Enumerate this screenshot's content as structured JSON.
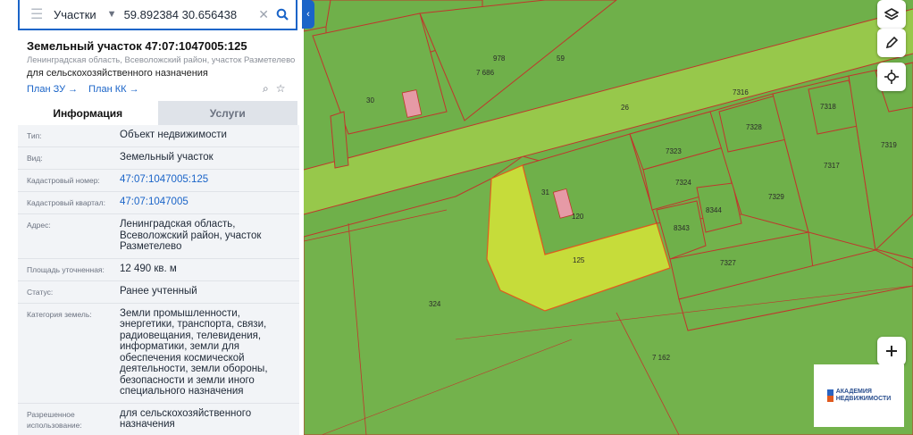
{
  "search": {
    "scope": "Участки",
    "query": "59.892384 30.656438"
  },
  "object": {
    "title": "Земельный участок 47:07:1047005:125",
    "address": "Ленинградская область, Всеволожский район, участок Разметелево",
    "purpose": "для сельскохозяйственного назначения",
    "links": [
      "План ЗУ →",
      "План КК →"
    ]
  },
  "tabs": [
    "Информация",
    "Услуги"
  ],
  "info_rows": [
    {
      "label": "Тип:",
      "value": "Объект недвижимости",
      "link": false
    },
    {
      "label": "Вид:",
      "value": "Земельный участок",
      "link": false
    },
    {
      "label": "Кадастровый номер:",
      "value": "47:07:1047005:125",
      "link": true
    },
    {
      "label": "Кадастровый квартал:",
      "value": "47:07:1047005",
      "link": true
    },
    {
      "label": "Адрес:",
      "value": "Ленинградская область, Всеволожский район, участок Разметелево",
      "link": false
    },
    {
      "label": "Площадь уточненная:",
      "value": "12 490 кв. м",
      "link": false
    },
    {
      "label": "Статус:",
      "value": "Ранее учтенный",
      "link": false
    },
    {
      "label": "Категория земель:",
      "value": "Земли промышленности, энергетики, транспорта, связи, радиовещания, телевидения, информатики, земли для обеспечения космической деятельности, земли обороны, безопасности и земли иного специального назначения",
      "link": false
    },
    {
      "label": "Разрешенное использование:",
      "value": "для сельскохозяйственного назначения",
      "link": false
    }
  ],
  "map": {
    "parcel_labels": [
      "978",
      "59",
      "7 686",
      "30",
      "26",
      "31",
      "125",
      "324",
      "7 162",
      "7316",
      "7318",
      "7328",
      "7319",
      "7323",
      "7324",
      "7317",
      "8344",
      "8343",
      "7329",
      "7327",
      "120"
    ],
    "colors": {
      "base": "#6fb04a",
      "road": "#97c84b",
      "selected": "#c6dc3a",
      "building": "#e69aa6",
      "border": "#c0362c",
      "accent": "#1a64c8"
    }
  },
  "brand": {
    "line1": "АКАДЕМИЯ",
    "line2": "НЕДВИЖИМОСТИ"
  }
}
